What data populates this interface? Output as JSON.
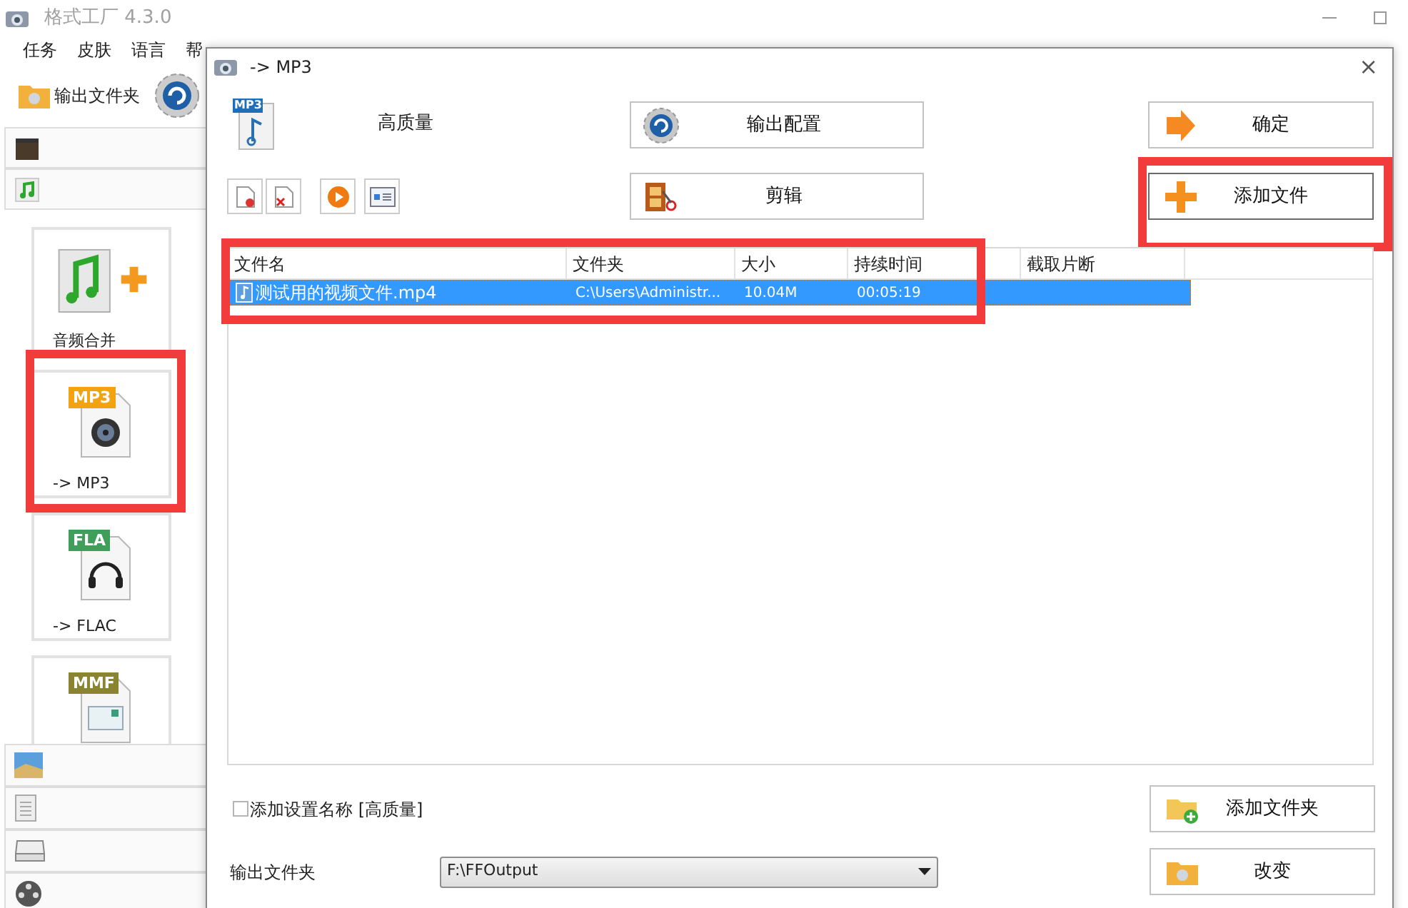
{
  "main_window": {
    "title": "格式工厂 4.3.0",
    "menu": [
      "任务",
      "皮肤",
      "语言",
      "帮"
    ],
    "toolbar": [
      {
        "label": "输出文件夹"
      }
    ],
    "tiles": [
      {
        "kind": "merge",
        "label": "音频合并",
        "highlighted": false
      },
      {
        "kind": "mp3",
        "badge": "MP3",
        "label": "-> MP3",
        "highlighted": true
      },
      {
        "kind": "flac",
        "badge": "FLA",
        "label": "-> FLAC",
        "highlighted": false
      },
      {
        "kind": "mmf",
        "badge": "MMF",
        "highlighted": false
      }
    ]
  },
  "dialog": {
    "title": "-> MP3",
    "close": "×",
    "format_badge": "MP3",
    "preset": "高质量",
    "buttons": [
      {
        "kind": "config",
        "label": "输出配置",
        "highlighted": false
      },
      {
        "kind": "clip",
        "label": "剪辑",
        "highlighted": false
      },
      {
        "kind": "ok",
        "label": "确定",
        "highlighted": false
      },
      {
        "kind": "add",
        "label": "添加文件",
        "highlighted": true
      }
    ],
    "table": {
      "highlighted": true,
      "columns": [
        "文件名",
        "文件夹",
        "大小",
        "持续时间",
        "截取片断"
      ],
      "rows": [
        {
          "selected": true,
          "cells": [
            "测试用的视频文件.mp4",
            "C:\\Users\\Administr...",
            "10.04M",
            "00:05:19",
            ""
          ]
        }
      ]
    },
    "checkbox": {
      "label": "添加设置名称 [高质量]",
      "checked": false
    },
    "add_folder_button": {
      "label": "添加文件夹"
    },
    "output_folder": {
      "label": "输出文件夹",
      "value": "F:\\FFOutput"
    },
    "change_button": {
      "label": "改变"
    }
  }
}
